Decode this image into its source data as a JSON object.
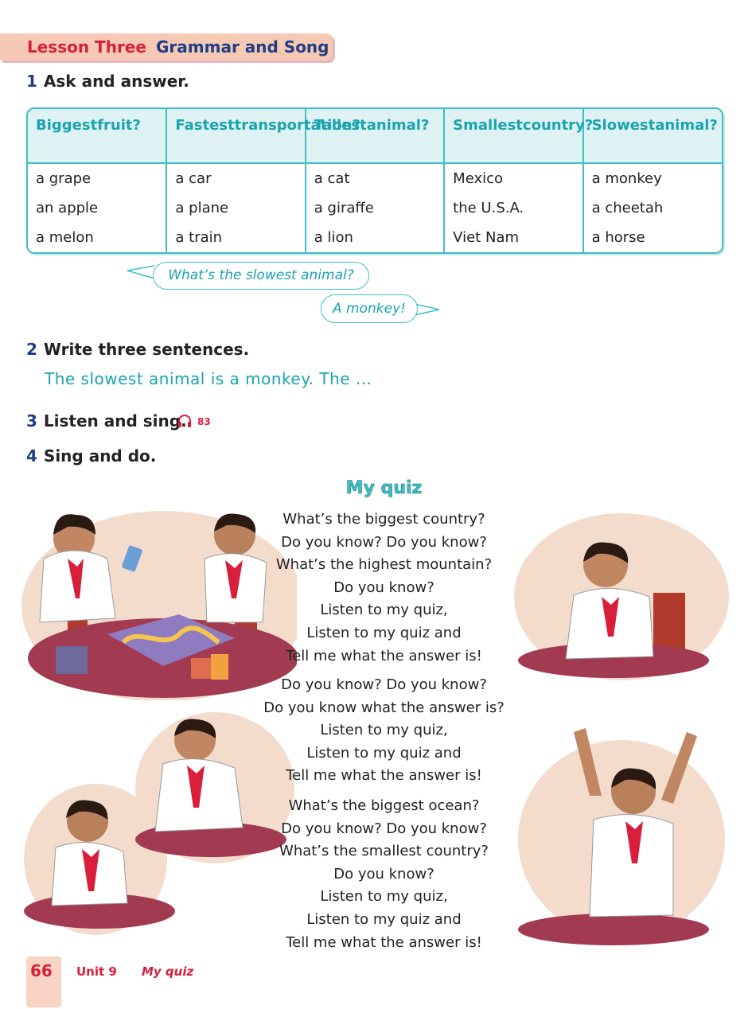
{
  "lesson": {
    "label": "Lesson Three",
    "title": "Grammar and Song"
  },
  "activities": [
    {
      "num": "1",
      "text": "Ask and answer."
    },
    {
      "num": "2",
      "text": "Write three sentences."
    },
    {
      "num": "3",
      "text": "Listen and sing."
    },
    {
      "num": "4",
      "text": "Sing and do."
    }
  ],
  "table": {
    "headers": [
      [
        "Biggest",
        "fruit?"
      ],
      [
        "Fastest",
        "transportation?"
      ],
      [
        "Tallest",
        "animal?"
      ],
      [
        "Smallest",
        "country?"
      ],
      [
        "Slowest",
        "animal?"
      ]
    ],
    "columns": [
      [
        "a grape",
        "an apple",
        "a melon"
      ],
      [
        "a car",
        "a plane",
        "a train"
      ],
      [
        "a cat",
        "a giraffe",
        "a lion"
      ],
      [
        "Mexico",
        "the U.S.A.",
        "Viet Nam"
      ],
      [
        "a monkey",
        "a cheetah",
        "a horse"
      ]
    ]
  },
  "dialogue": {
    "question": "What’s the slowest animal?",
    "answer": "A monkey!"
  },
  "sample_sentence": "The slowest animal is a monkey. The ...",
  "audio": {
    "icon": "headphones-icon",
    "track": "83"
  },
  "song": {
    "title": "My quiz",
    "verse1": [
      "What’s the biggest country?",
      "Do you know? Do you know?",
      "What’s the highest mountain?",
      "Do you know?",
      "Listen to my quiz,",
      "Listen to my quiz and",
      "Tell me what the answer is!"
    ],
    "chorus": [
      "Do you know? Do you know?",
      "Do you know what the answer is?",
      "Listen to my quiz,",
      "Listen to my quiz and",
      "Tell me what the answer is!"
    ],
    "verse2": [
      "What’s the biggest ocean?",
      "Do you know? Do you know?",
      "What’s the smallest country?",
      "Do you know?",
      "Listen to my quiz,",
      "Listen to my quiz and",
      "Tell me what the answer is!"
    ]
  },
  "footer": {
    "page": "66",
    "unit": "Unit 9",
    "unit_title": "My quiz"
  },
  "colors": {
    "red": "#d81e3a",
    "navy": "#1f3e86",
    "teal": "#3fbfc4",
    "peach": "#f6c9b4"
  }
}
